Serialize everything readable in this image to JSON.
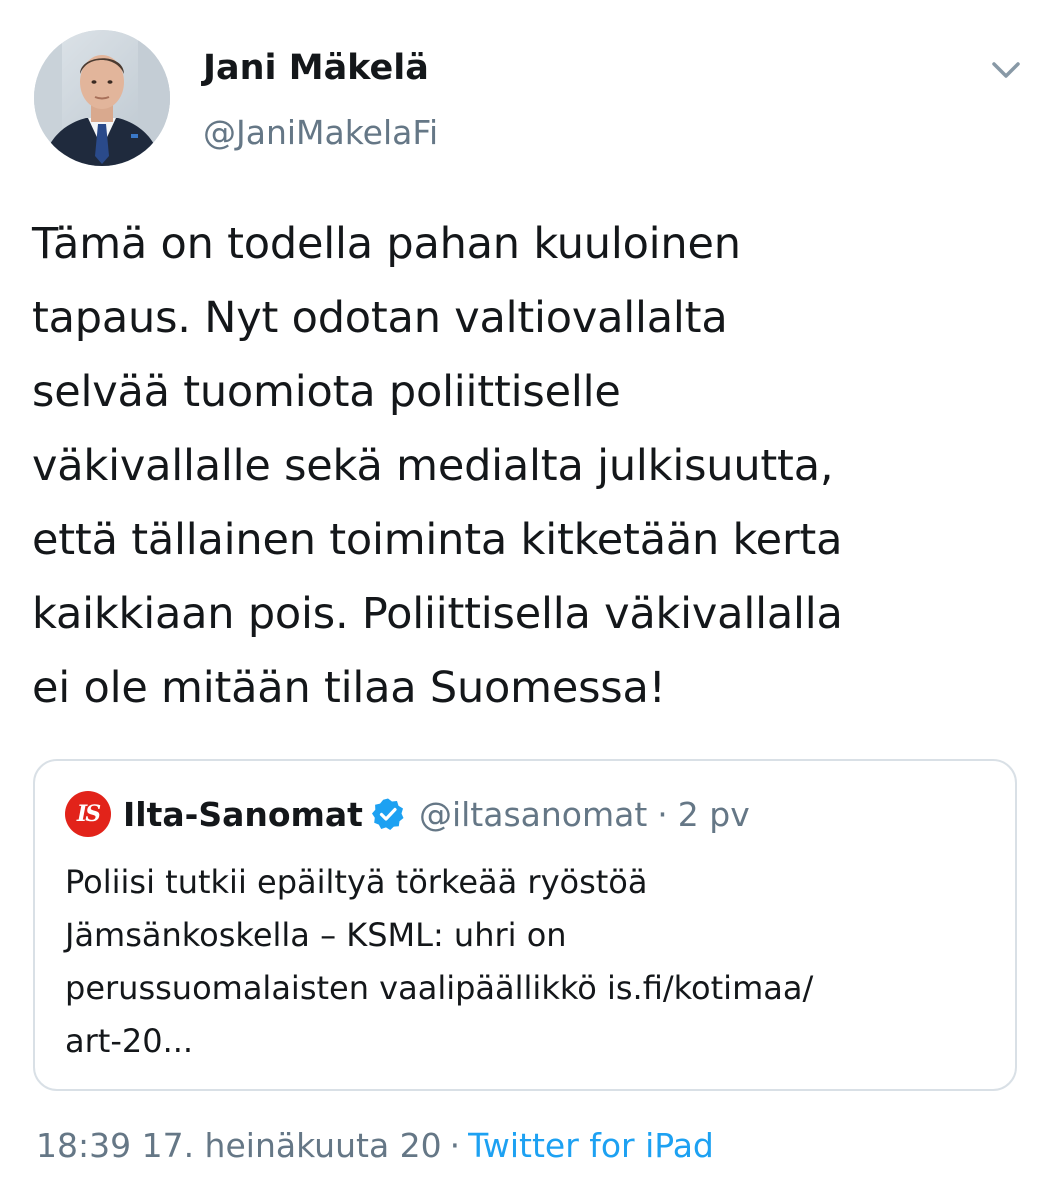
{
  "author": {
    "name": "Jani Mäkelä",
    "handle": "@JaniMakelaFi"
  },
  "icons": {
    "menu": "chevron-down-icon",
    "verified": "verified-badge-icon",
    "logo": "ilta-sanomat-logo"
  },
  "tweet": {
    "lines": [
      "Tämä on todella pahan kuuloinen",
      "tapaus. Nyt odotan valtiovallalta",
      "selvää tuomiota poliittiselle",
      "väkivallalle sekä medialta julkisuutta,",
      "että tällainen toiminta kitketään kerta",
      "kaikkiaan pois. Poliittisella väkivallalla",
      "ei ole mitään tilaa Suomessa!"
    ]
  },
  "quote": {
    "logo_text": "IS",
    "name": "Ilta-Sanomat",
    "handle": "@iltasanomat",
    "separator": "·",
    "time": "2 pv",
    "lines": [
      "Poliisi tutkii epäiltyä törkeää ryöstöä",
      "Jämsänkoskella – KSML: uhri on",
      "perussuomalaisten vaalipäällikkö is.fi/kotimaa/",
      "art-20..."
    ]
  },
  "footer": {
    "timestamp": "18:39 17. heinäkuuta 20",
    "separator": "·",
    "source": "Twitter for iPad"
  },
  "colors": {
    "text": "#14171a",
    "secondary": "#657786",
    "link": "#1da1f2",
    "border": "#d9e0e6",
    "logo_red": "#e2231a",
    "verified_blue": "#1da1f2"
  }
}
